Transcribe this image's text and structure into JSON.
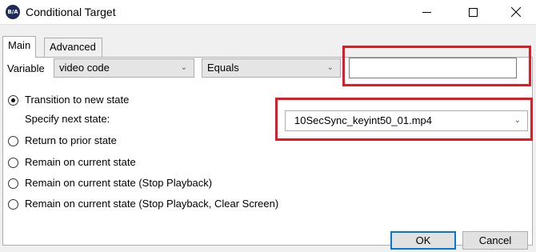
{
  "window": {
    "title": "Conditional Target",
    "app_icon_text": "B/A",
    "controls": [
      "minimize-icon",
      "maximize-icon",
      "close-icon"
    ]
  },
  "tabs": [
    {
      "label": "Main",
      "selected": true
    },
    {
      "label": "Advanced",
      "selected": false
    }
  ],
  "condition": {
    "variable_label": "Variable",
    "variable_value": "video code",
    "operator_value": "Equals",
    "compare_value": ""
  },
  "options": [
    {
      "label": "Transition to new state",
      "checked": true
    },
    {
      "label": "Return to prior state",
      "checked": false
    },
    {
      "label": "Remain on current state",
      "checked": false
    },
    {
      "label": "Remain on current state (Stop Playback)",
      "checked": false
    },
    {
      "label": "Remain on current state (Stop Playback, Clear Screen)",
      "checked": false
    }
  ],
  "next_state": {
    "label": "Specify next state:",
    "value": "10SecSync_keyint50_01.mp4"
  },
  "buttons": {
    "ok": "OK",
    "cancel": "Cancel"
  },
  "colors": {
    "highlight": "#e01b24",
    "dialog_bg": "#f0f0f0",
    "focus_border": "#0078d7"
  }
}
